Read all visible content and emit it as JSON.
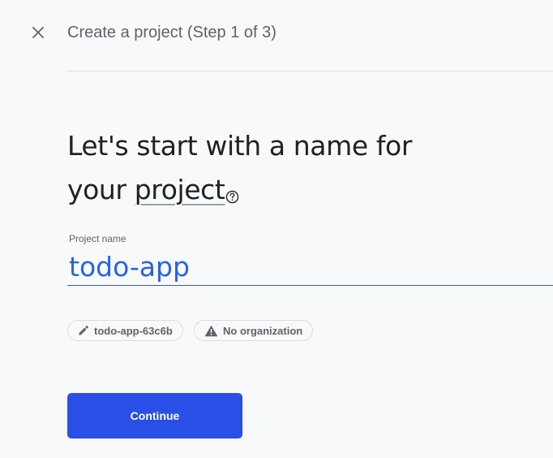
{
  "header": {
    "close_icon": "close-icon",
    "step_title": "Create a project (Step 1 of 3)"
  },
  "main": {
    "headline_line1": "Let's start with a name for",
    "headline_line2_prefix": "your ",
    "headline_term": "project",
    "help_icon": "help-circle-icon",
    "project_name_label": "Project name",
    "project_name_value": "todo-app",
    "project_id_chip": "todo-app-63c6b",
    "project_id_icon": "pencil-icon",
    "organization_chip": "No organization",
    "organization_icon": "warning-icon",
    "continue_label": "Continue"
  },
  "colors": {
    "background": "#f8f9fa",
    "accent_blue": "#2a4ee8",
    "input_text": "#2962e3",
    "muted_text": "#5f6368"
  }
}
